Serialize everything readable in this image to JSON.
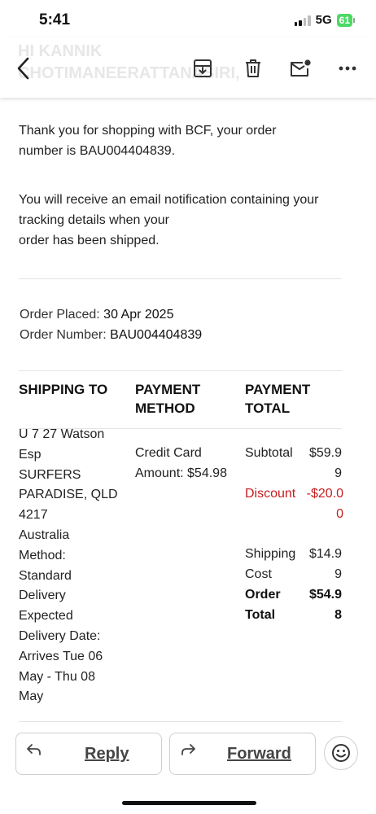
{
  "status_bar": {
    "time": "5:41",
    "network": "5G",
    "battery": "61"
  },
  "header": {
    "ghost_title_line1": "HI KANNIK",
    "ghost_title_line2": "CHOTIMANEERATTANASIRI,",
    "icons": [
      "back-arrow-icon",
      "archive-icon",
      "trash-icon",
      "mark-unread-icon",
      "more-icon"
    ]
  },
  "email": {
    "intro_line1": "Thank you for shopping with BCF, your order",
    "intro_line2": "number is BAU004404839.",
    "notify_line1": "You will receive an email notification containing your",
    "notify_line2": "tracking details when your",
    "notify_line3": "order has been shipped.",
    "order_placed_label": "Order Placed:",
    "order_placed_value": "30 Apr 2025",
    "order_number_label": "Order Number:",
    "order_number_value": "BAU004404839"
  },
  "table": {
    "headers": {
      "shipping": "SHIPPING TO",
      "payment_method_1": "PAYMENT",
      "payment_method_2": "METHOD",
      "payment_total_1": "PAYMENT",
      "payment_total_2": "TOTAL"
    },
    "shipping_lines": [
      "U 7 27 Watson",
      "Esp",
      "SURFERS",
      "PARADISE, QLD",
      "4217",
      "Australia",
      "Method:",
      "Standard",
      "Delivery",
      "Expected",
      "Delivery Date:",
      "Arrives Tue 06",
      "May - Thu 08",
      "May"
    ],
    "payment_method_lines": [
      "Credit Card",
      "Amount: $54.98"
    ],
    "totals": {
      "subtotal_label": "Subtotal",
      "subtotal_value": "$59.99",
      "discount_label": "Discount",
      "discount_value": "-$20.00",
      "shipping_label": "Shipping Cost",
      "shipping_value": "$14.99",
      "order_total_label": "Order Total",
      "order_total_value": "$54.98"
    }
  },
  "actions": {
    "reply": "Reply",
    "forward": "Forward"
  },
  "colors": {
    "discount": "#c41e1e",
    "battery": "#4cd964"
  }
}
